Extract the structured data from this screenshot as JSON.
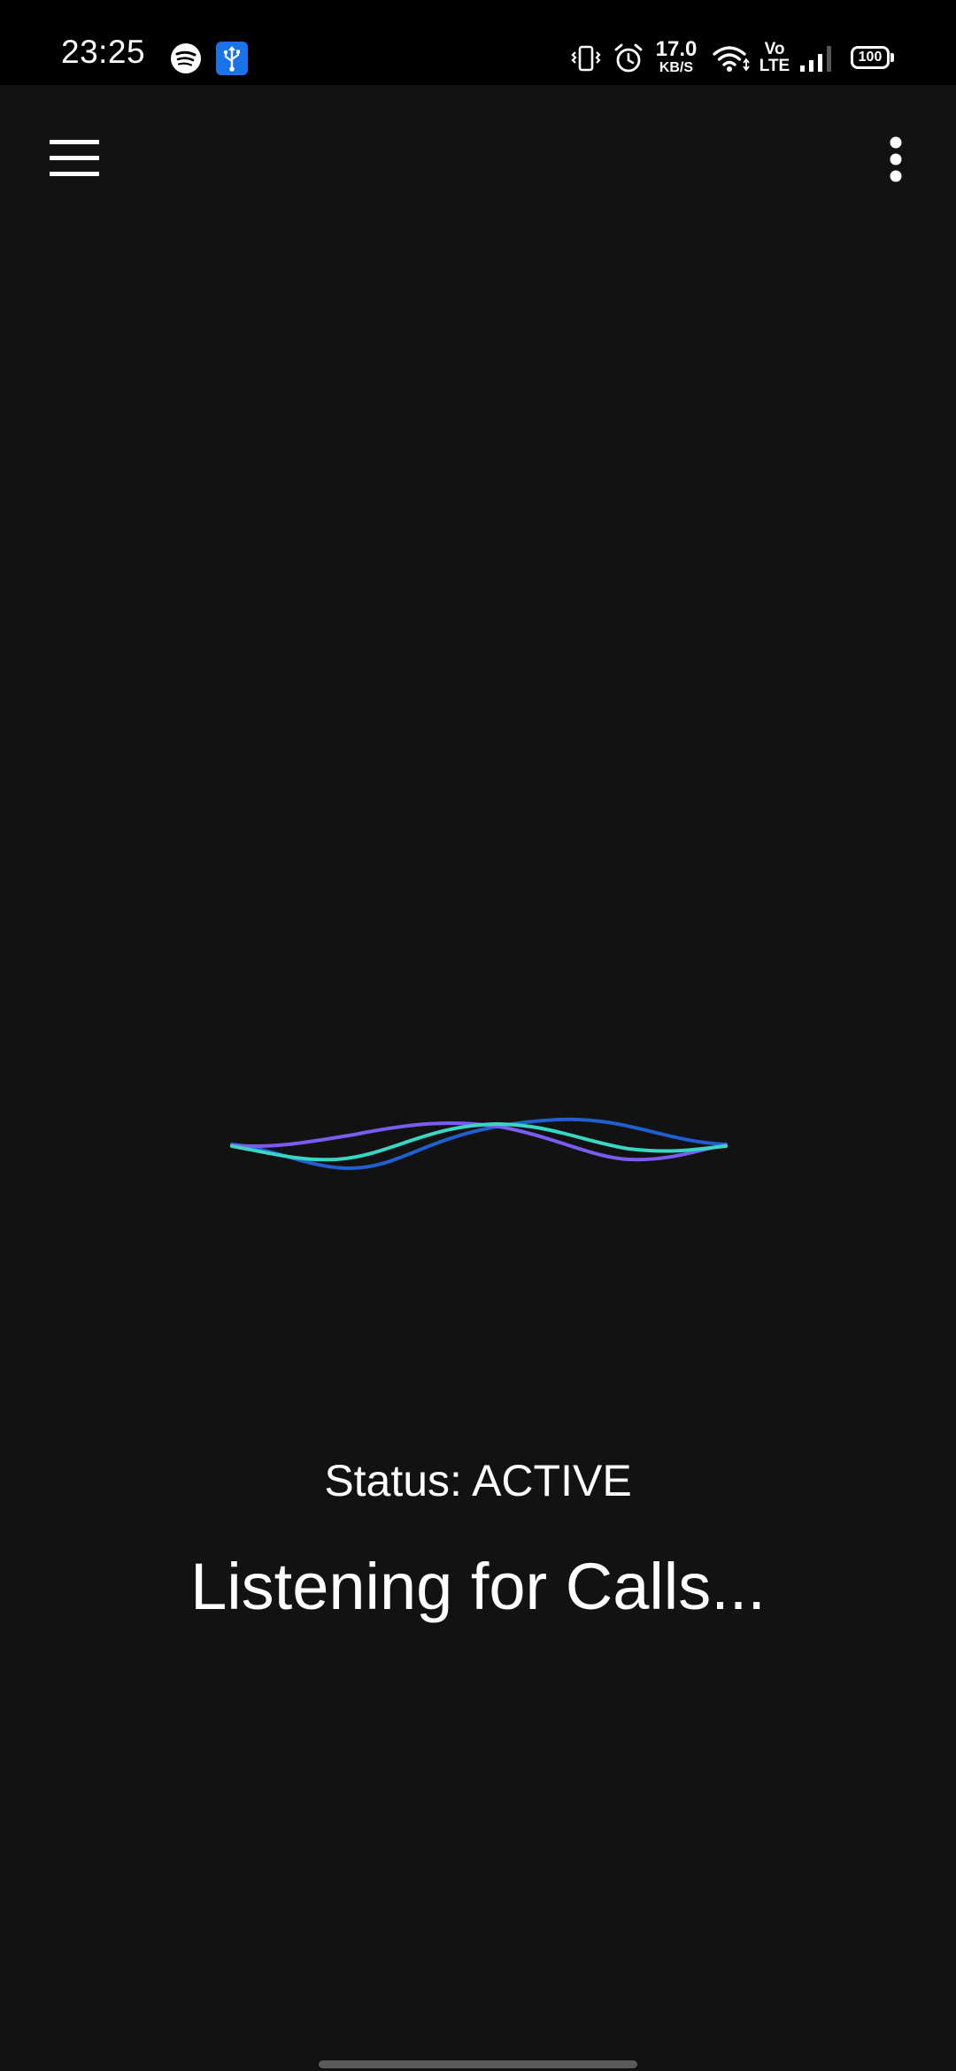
{
  "status_bar": {
    "time": "23:25",
    "net_speed_value": "17.0",
    "net_speed_unit": "KB/S",
    "volte_top": "Vo",
    "volte_bottom": "LTE",
    "battery": "100",
    "icons": [
      "spotify-icon",
      "usb-debugging-icon",
      "vibrate-icon",
      "alarm-icon",
      "wifi-icon",
      "volte-icon",
      "signal-icon",
      "battery-icon"
    ]
  },
  "toolbar": {
    "menu_icon": "hamburger-menu-icon",
    "overflow_icon": "more-vertical-icon"
  },
  "main": {
    "status_text": "Status: ACTIVE",
    "listening_text": "Listening for Calls..."
  },
  "colors": {
    "background": "#121213",
    "status_bar_bg": "#000000",
    "wave_purple": "#7b5cf0",
    "wave_teal": "#3ad6c4",
    "wave_blue": "#1f5fd0",
    "usb_badge": "#1a73e8"
  }
}
